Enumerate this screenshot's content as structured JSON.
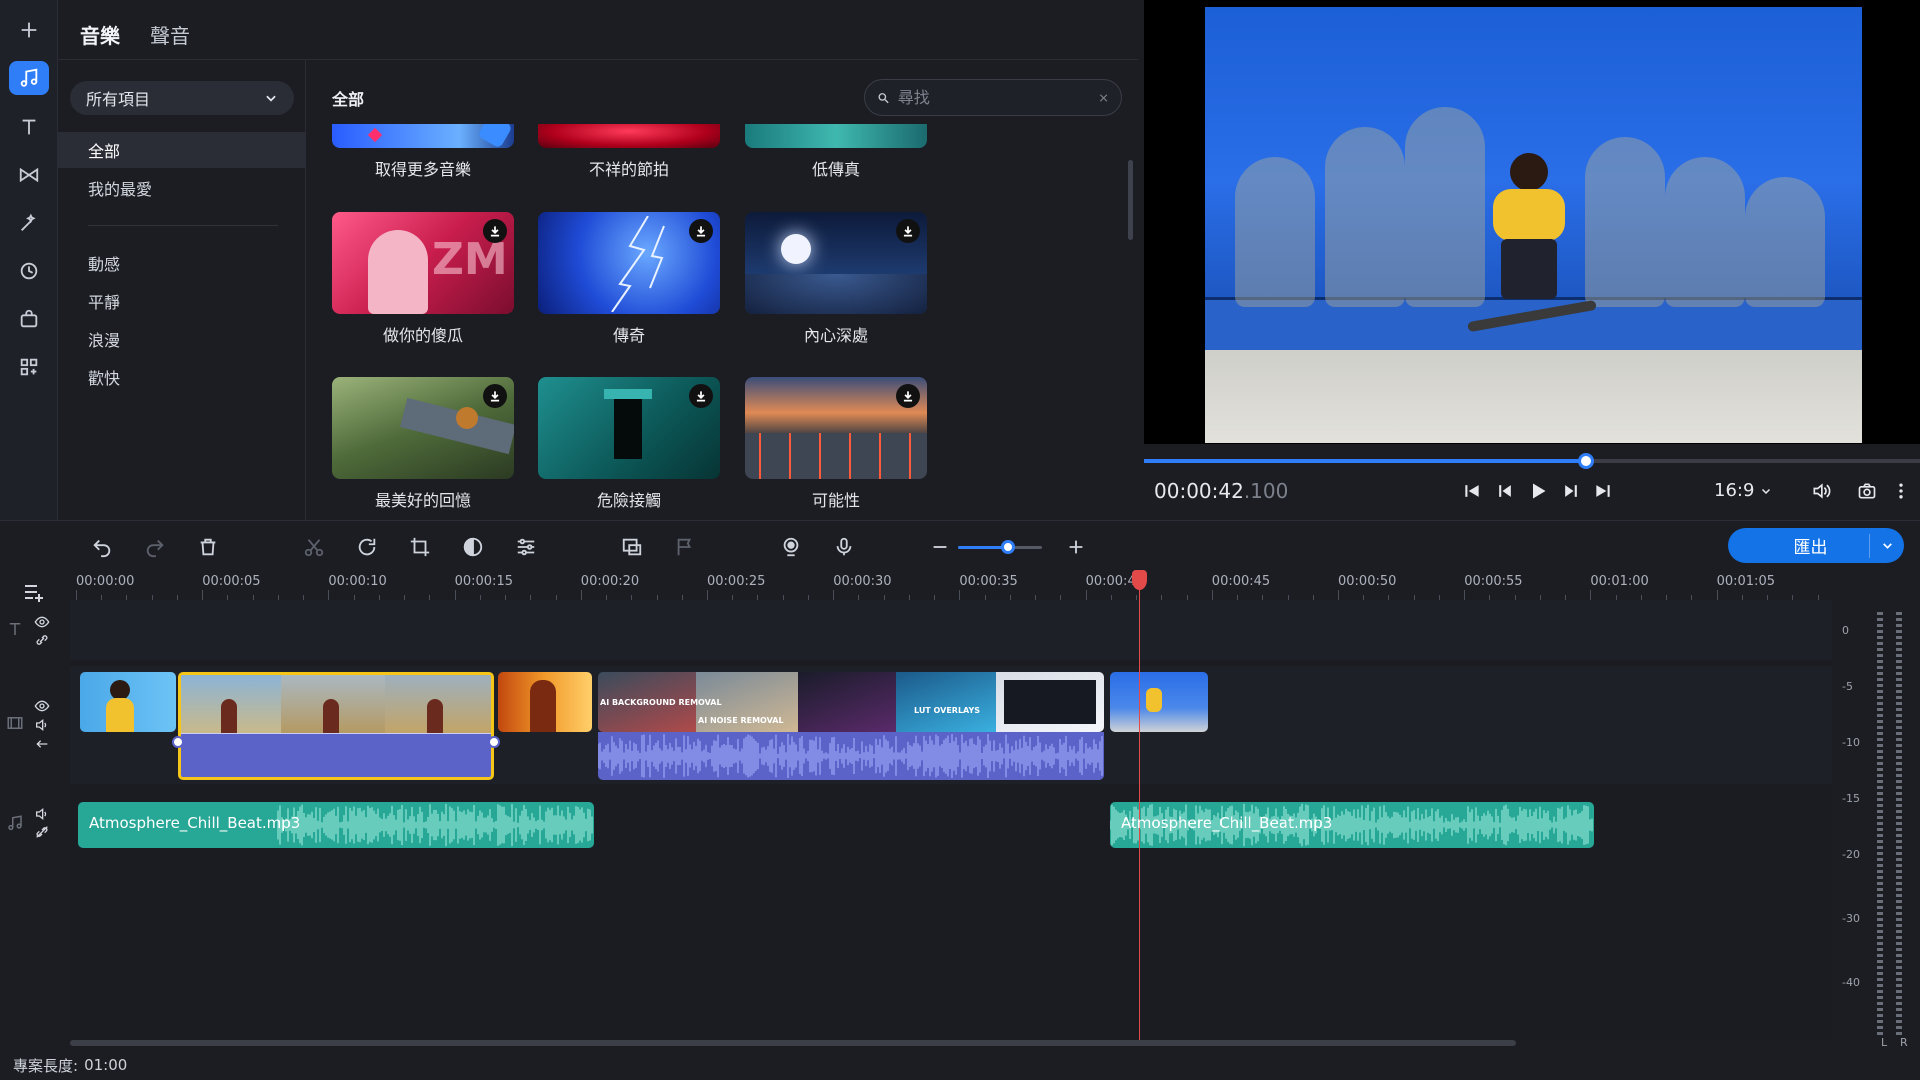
{
  "library": {
    "tabs": [
      "音樂",
      "聲音"
    ],
    "dropdown": "所有項目",
    "categories": [
      "全部",
      "我的最愛",
      "動感",
      "平靜",
      "浪漫",
      "歡快"
    ],
    "grid_title": "全部",
    "search_placeholder": "尋找",
    "tracks": [
      "取得更多音樂",
      "不祥的節拍",
      "低傳真",
      "做你的傻瓜",
      "傳奇",
      "內心深處",
      "最美好的回憶",
      "危險接觸",
      "可能性"
    ]
  },
  "player": {
    "timecode_main": "00:00:42",
    "timecode_ms": ".100",
    "progress": 0.57,
    "aspect_ratio": "16:9"
  },
  "toolbar": {
    "export_label": "匯出",
    "zoom_level": 0.6
  },
  "timeline": {
    "ruler_labels": [
      "00:00:00",
      "00:00:05",
      "00:00:10",
      "00:00:15",
      "00:00:20",
      "00:00:25",
      "00:00:30",
      "00:00:35",
      "00:00:4",
      "00:00:45",
      "00:00:50",
      "00:00:55",
      "00:01:00",
      "00:01:05"
    ],
    "music_clips": [
      "Atmosphere_Chill_Beat.mp3",
      "Atmosphere_Chill_Beat.mp3"
    ],
    "clip_texts": [
      "AI BACKGROUND REMOVAL",
      "AI NOISE REMOVAL",
      "LUT OVERLAYS"
    ],
    "meter_labels": [
      "0",
      "-5",
      "-10",
      "-15",
      "-20",
      "-30",
      "-40"
    ],
    "meter_channels": [
      "L",
      "R"
    ]
  },
  "status": {
    "project_length_label": "專案長度:",
    "project_length_value": "01:00"
  },
  "colors": {
    "accent": "#2f7ef7",
    "music_clip": "#27a796",
    "playhead": "#e24a4a",
    "selection": "#f5c518"
  }
}
